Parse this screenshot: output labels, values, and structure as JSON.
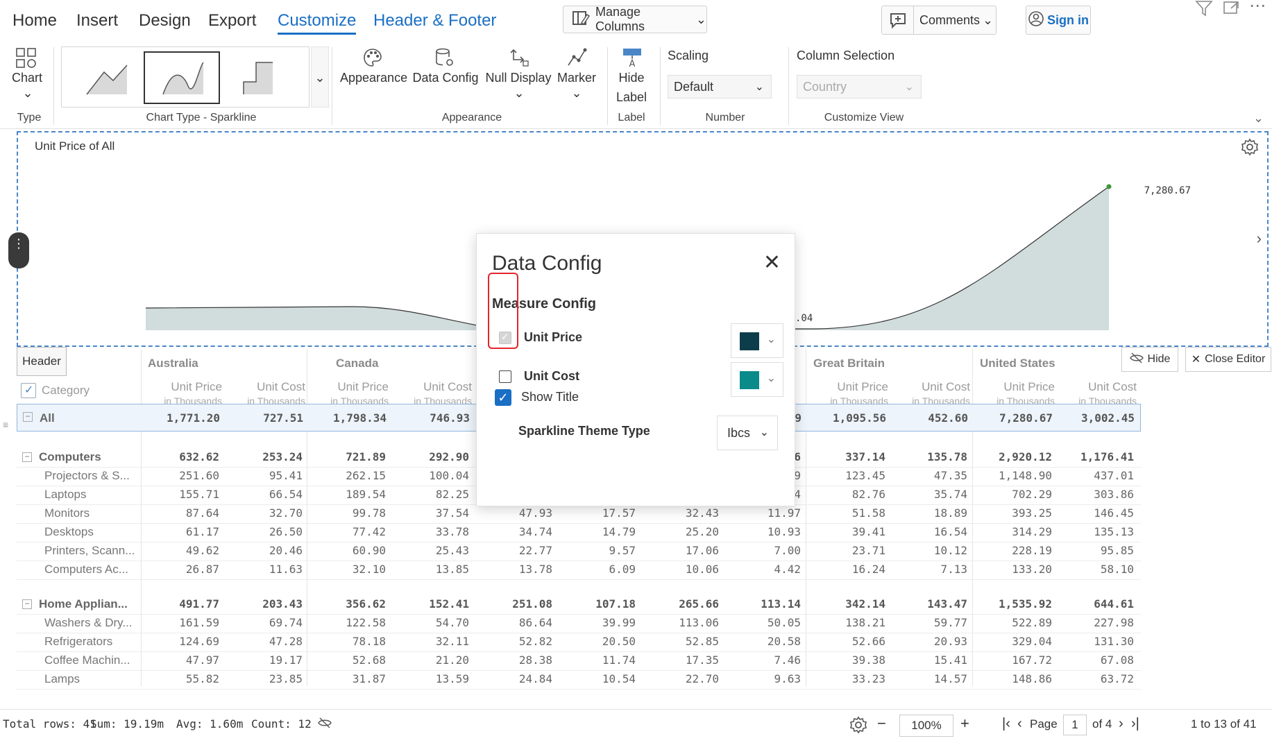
{
  "menu": {
    "tabs": [
      "Home",
      "Insert",
      "Design",
      "Export",
      "Customize",
      "Header & Footer"
    ],
    "manage_columns": "Manage Columns",
    "comments": "Comments",
    "sign_in": "Sign in"
  },
  "ribbon": {
    "chart_type_button": "Chart",
    "type_group": "Type",
    "gallery_group": "Chart Type - Sparkline",
    "appearance": "Appearance",
    "data_config": "Data Config",
    "null_display": "Null Display",
    "marker": "Marker",
    "appearance_group": "Appearance",
    "hide": "Hide",
    "label": "Label",
    "label_group": "Label",
    "scaling_title": "Scaling",
    "scaling_value": "Default",
    "number_group": "Number",
    "column_selection_title": "Column Selection",
    "column_selection_placeholder": "Country",
    "customize_view_group": "Customize View"
  },
  "chart": {
    "title": "Unit Price of All",
    "peak_label": "7,280.67",
    "partial_label": ".04",
    "fill_color": "#d1dcdc",
    "line_color": "#333333",
    "marker_color": "#3a9a3a"
  },
  "table": {
    "header_tag": "Header",
    "category": "Category",
    "countries": [
      "Australia",
      "Canada",
      "Great Britain",
      "United States"
    ],
    "unit_price": "Unit Price",
    "unit_cost": "Unit Cost",
    "in_thousands": "in Thousands",
    "hide_button": "Hide",
    "close_editor": "Close Editor",
    "rows": [
      {
        "label": "All",
        "kind": "all",
        "values": [
          "1,771.20",
          "727.51",
          "1,798.34",
          "746.93",
          "",
          "",
          "",
          "9",
          "1,095.56",
          "452.60",
          "7,280.67",
          "3,002.45"
        ]
      },
      {
        "label": "Computers",
        "kind": "group",
        "values": [
          "632.62",
          "253.24",
          "721.89",
          "292.90",
          "",
          "",
          "",
          "6",
          "337.14",
          "135.78",
          "2,920.12",
          "1,176.41"
        ]
      },
      {
        "label": "Projectors & S...",
        "kind": "item",
        "values": [
          "251.60",
          "95.41",
          "262.15",
          "100.04",
          "",
          "",
          "",
          "9",
          "123.45",
          "47.35",
          "1,148.90",
          "437.01"
        ]
      },
      {
        "label": "Laptops",
        "kind": "item",
        "values": [
          "155.71",
          "66.54",
          "189.54",
          "82.25",
          "",
          "",
          "",
          "4",
          "82.76",
          "35.74",
          "702.29",
          "303.86"
        ]
      },
      {
        "label": "Monitors",
        "kind": "item",
        "values": [
          "87.64",
          "32.70",
          "99.78",
          "37.54",
          "47.93",
          "17.57",
          "32.43",
          "11.97",
          "51.58",
          "18.89",
          "393.25",
          "146.45"
        ]
      },
      {
        "label": "Desktops",
        "kind": "item",
        "values": [
          "61.17",
          "26.50",
          "77.42",
          "33.78",
          "34.74",
          "14.79",
          "25.20",
          "10.93",
          "39.41",
          "16.54",
          "314.29",
          "135.13"
        ]
      },
      {
        "label": "Printers, Scann...",
        "kind": "item",
        "values": [
          "49.62",
          "20.46",
          "60.90",
          "25.43",
          "22.77",
          "9.57",
          "17.06",
          "7.00",
          "23.71",
          "10.12",
          "228.19",
          "95.85"
        ]
      },
      {
        "label": "Computers Ac...",
        "kind": "item",
        "values": [
          "26.87",
          "11.63",
          "32.10",
          "13.85",
          "13.78",
          "6.09",
          "10.06",
          "4.42",
          "16.24",
          "7.13",
          "133.20",
          "58.10"
        ]
      },
      {
        "label": "Home Applian...",
        "kind": "group",
        "values": [
          "491.77",
          "203.43",
          "356.62",
          "152.41",
          "251.08",
          "107.18",
          "265.66",
          "113.14",
          "342.14",
          "143.47",
          "1,535.92",
          "644.61"
        ]
      },
      {
        "label": "Washers & Dry...",
        "kind": "item",
        "values": [
          "161.59",
          "69.74",
          "122.58",
          "54.70",
          "86.64",
          "39.99",
          "113.06",
          "50.05",
          "138.21",
          "59.77",
          "522.89",
          "227.98"
        ]
      },
      {
        "label": "Refrigerators",
        "kind": "item",
        "values": [
          "124.69",
          "47.28",
          "78.18",
          "32.11",
          "52.82",
          "20.50",
          "52.85",
          "20.58",
          "52.66",
          "20.93",
          "329.04",
          "131.30"
        ]
      },
      {
        "label": "Coffee Machin...",
        "kind": "item",
        "values": [
          "47.97",
          "19.17",
          "52.68",
          "21.20",
          "28.38",
          "11.74",
          "17.35",
          "7.46",
          "39.38",
          "15.41",
          "167.72",
          "67.08"
        ]
      },
      {
        "label": "Lamps",
        "kind": "item",
        "values": [
          "55.82",
          "23.85",
          "31.87",
          "13.59",
          "24.84",
          "10.54",
          "22.70",
          "9.63",
          "33.23",
          "14.57",
          "148.86",
          "63.72"
        ]
      }
    ]
  },
  "dialog": {
    "title": "Data Config",
    "section": "Measure Config",
    "measures": [
      {
        "label": "Unit Price",
        "checked": true,
        "color": "#0d3d4a"
      },
      {
        "label": "Unit Cost",
        "checked": false,
        "color": "#0b8a8a"
      }
    ],
    "show_title": "Show Title",
    "theme_label": "Sparkline Theme Type",
    "theme_value": "Ibcs"
  },
  "status": {
    "total_rows": "Total rows: 41",
    "sum": "Sum: 19.19m",
    "avg": "Avg: 1.60m",
    "count": "Count: 12",
    "zoom": "100%",
    "page_label": "Page",
    "page_value": "1",
    "page_of": "of 4",
    "range": "1 to 13 of 41"
  }
}
